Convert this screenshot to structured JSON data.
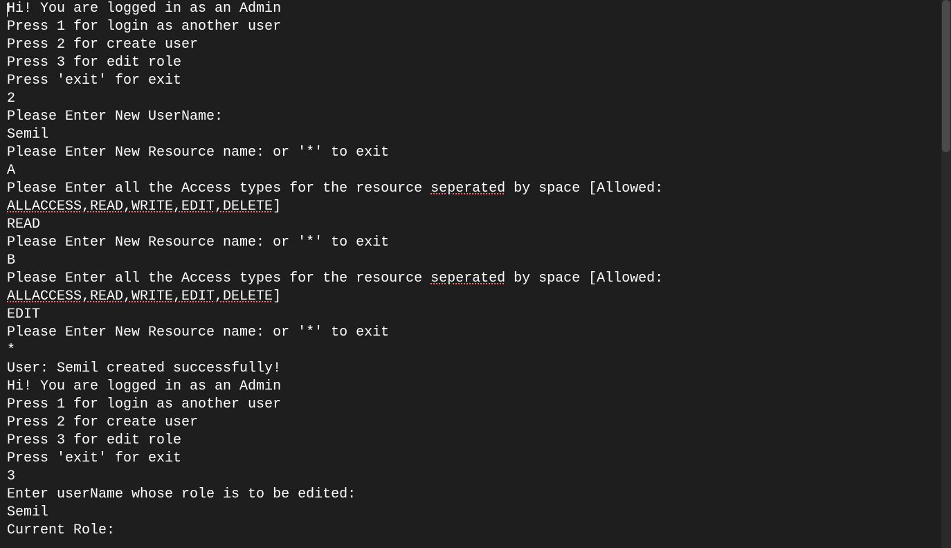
{
  "terminal": {
    "lines": [
      {
        "segments": [
          {
            "text": "Hi! You are logged in as an Admin",
            "spellcheck": false
          }
        ],
        "cursor": true
      },
      {
        "segments": [
          {
            "text": "Press 1 for login as another user",
            "spellcheck": false
          }
        ]
      },
      {
        "segments": [
          {
            "text": "Press 2 for create user",
            "spellcheck": false
          }
        ]
      },
      {
        "segments": [
          {
            "text": "Press 3 for edit role",
            "spellcheck": false
          }
        ]
      },
      {
        "segments": [
          {
            "text": "Press 'exit' for exit",
            "spellcheck": false
          }
        ]
      },
      {
        "segments": [
          {
            "text": "2",
            "spellcheck": false
          }
        ]
      },
      {
        "segments": [
          {
            "text": "Please Enter New UserName:",
            "spellcheck": false
          }
        ]
      },
      {
        "segments": [
          {
            "text": "Semil",
            "spellcheck": false
          }
        ]
      },
      {
        "segments": [
          {
            "text": "Please Enter New Resource name: or '*' to exit",
            "spellcheck": false
          }
        ]
      },
      {
        "segments": [
          {
            "text": "A",
            "spellcheck": false
          }
        ]
      },
      {
        "segments": [
          {
            "text": "Please Enter all the Access types for the resource ",
            "spellcheck": false
          },
          {
            "text": "seperated",
            "spellcheck": true
          },
          {
            "text": " by space [Allowed: ",
            "spellcheck": false
          },
          {
            "text": "ALLACCESS,READ,WRITE,EDIT,DELETE",
            "spellcheck": true
          },
          {
            "text": "]",
            "spellcheck": false
          }
        ]
      },
      {
        "segments": [
          {
            "text": "READ",
            "spellcheck": false
          }
        ]
      },
      {
        "segments": [
          {
            "text": "Please Enter New Resource name: or '*' to exit",
            "spellcheck": false
          }
        ]
      },
      {
        "segments": [
          {
            "text": "B",
            "spellcheck": false
          }
        ]
      },
      {
        "segments": [
          {
            "text": "Please Enter all the Access types for the resource ",
            "spellcheck": false
          },
          {
            "text": "seperated",
            "spellcheck": true
          },
          {
            "text": " by space [Allowed: ",
            "spellcheck": false
          },
          {
            "text": "ALLACCESS,READ,WRITE,EDIT,DELETE",
            "spellcheck": true
          },
          {
            "text": "]",
            "spellcheck": false
          }
        ]
      },
      {
        "segments": [
          {
            "text": "EDIT",
            "spellcheck": false
          }
        ]
      },
      {
        "segments": [
          {
            "text": "Please Enter New Resource name: or '*' to exit",
            "spellcheck": false
          }
        ]
      },
      {
        "segments": [
          {
            "text": "*",
            "spellcheck": false
          }
        ]
      },
      {
        "segments": [
          {
            "text": "User: Semil created successfully!",
            "spellcheck": false
          }
        ]
      },
      {
        "segments": [
          {
            "text": "Hi! You are logged in as an Admin",
            "spellcheck": false
          }
        ]
      },
      {
        "segments": [
          {
            "text": "Press 1 for login as another user",
            "spellcheck": false
          }
        ]
      },
      {
        "segments": [
          {
            "text": "Press 2 for create user",
            "spellcheck": false
          }
        ]
      },
      {
        "segments": [
          {
            "text": "Press 3 for edit role",
            "spellcheck": false
          }
        ]
      },
      {
        "segments": [
          {
            "text": "Press 'exit' for exit",
            "spellcheck": false
          }
        ]
      },
      {
        "segments": [
          {
            "text": "3",
            "spellcheck": false
          }
        ]
      },
      {
        "segments": [
          {
            "text": "Enter userName whose role is to be edited:",
            "spellcheck": false
          }
        ]
      },
      {
        "segments": [
          {
            "text": "Semil",
            "spellcheck": false
          }
        ]
      },
      {
        "segments": [
          {
            "text": "Current Role:",
            "spellcheck": false
          }
        ]
      }
    ]
  }
}
